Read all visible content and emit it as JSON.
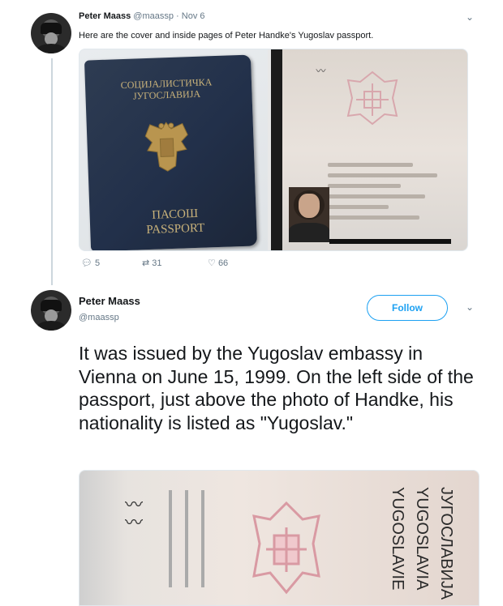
{
  "tweet1": {
    "author_name": "Peter Maass",
    "author_handle": "@maassp",
    "timestamp": "Nov 6",
    "text": "Here are the cover and inside pages of Peter Handke's Yugoslav passport.",
    "cover": {
      "top_text": "СОЦИЈАЛИСТИЧКА ЈУГОСЛАВИЈА",
      "bottom_text_1": "ПАСОШ",
      "bottom_text_2": "PASSPORT"
    },
    "actions": {
      "reply_count": "5",
      "retweet_count": "31",
      "like_count": "66"
    }
  },
  "tweet2": {
    "author_name": "Peter Maass",
    "author_handle": "@maassp",
    "follow_label": "Follow",
    "text": "It was issued by the Yugoslav embassy in Vienna on June 15, 1999. On the left side of the passport, just above the photo of Handke, his nationality is listed as \"Yugoslav.\"",
    "media_vertical_texts": [
      "ЈУГОСЛАВИЈА",
      "YUGOSLAVIA",
      "YUGOSLAVIE"
    ]
  },
  "colors": {
    "accent": "#1da1f2",
    "text_secondary": "#657786",
    "thread_line": "#ccd6dd"
  }
}
